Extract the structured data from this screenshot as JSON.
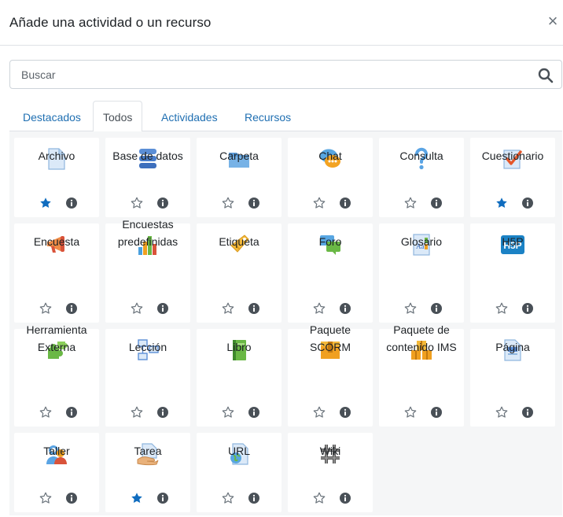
{
  "modal": {
    "title": "Añade una actividad o un recurso",
    "close_label": "×"
  },
  "search": {
    "placeholder": "Buscar",
    "value": ""
  },
  "tabs": [
    {
      "label": "Destacados",
      "active": false
    },
    {
      "label": "Todos",
      "active": true
    },
    {
      "label": "Actividades",
      "active": false
    },
    {
      "label": "Recursos",
      "active": false
    }
  ],
  "colors": {
    "accent": "#1f6fb2",
    "star_filled": "#0f6cbf",
    "info": "#495057",
    "grid_bg": "#f5f6f7"
  },
  "modules": [
    {
      "name": "Archivo",
      "icon": "file-icon",
      "starred": true
    },
    {
      "name": "Base de datos",
      "icon": "database-icon",
      "starred": false
    },
    {
      "name": "Carpeta",
      "icon": "folder-icon",
      "starred": false
    },
    {
      "name": "Chat",
      "icon": "chat-icon",
      "starred": false
    },
    {
      "name": "Consulta",
      "icon": "question-icon",
      "starred": false
    },
    {
      "name": "Cuestionario",
      "icon": "quiz-icon",
      "starred": true
    },
    {
      "name": "Encuesta",
      "icon": "megaphone-icon",
      "starred": false
    },
    {
      "name": "Encuestas predefinidas",
      "icon": "bar-chart-icon",
      "starred": false
    },
    {
      "name": "Etiqueta",
      "icon": "tag-icon",
      "starred": false
    },
    {
      "name": "Foro",
      "icon": "forum-icon",
      "starred": false
    },
    {
      "name": "Glosario",
      "icon": "glossary-icon",
      "starred": false
    },
    {
      "name": "H5P",
      "icon": "h5p-icon",
      "starred": false
    },
    {
      "name": "Herramienta Externa",
      "icon": "puzzle-icon",
      "starred": false
    },
    {
      "name": "Lección",
      "icon": "lesson-icon",
      "starred": false
    },
    {
      "name": "Libro",
      "icon": "book-icon",
      "starred": false
    },
    {
      "name": "Paquete SCORM",
      "icon": "package-icon",
      "starred": false
    },
    {
      "name": "Paquete de contenido IMS",
      "icon": "ims-package-icon",
      "starred": false
    },
    {
      "name": "Página",
      "icon": "page-icon",
      "starred": false
    },
    {
      "name": "Taller",
      "icon": "workshop-icon",
      "starred": false
    },
    {
      "name": "Tarea",
      "icon": "assignment-icon",
      "starred": true
    },
    {
      "name": "URL",
      "icon": "url-icon",
      "starred": false
    },
    {
      "name": "Wiki",
      "icon": "wiki-icon",
      "starred": false
    }
  ]
}
